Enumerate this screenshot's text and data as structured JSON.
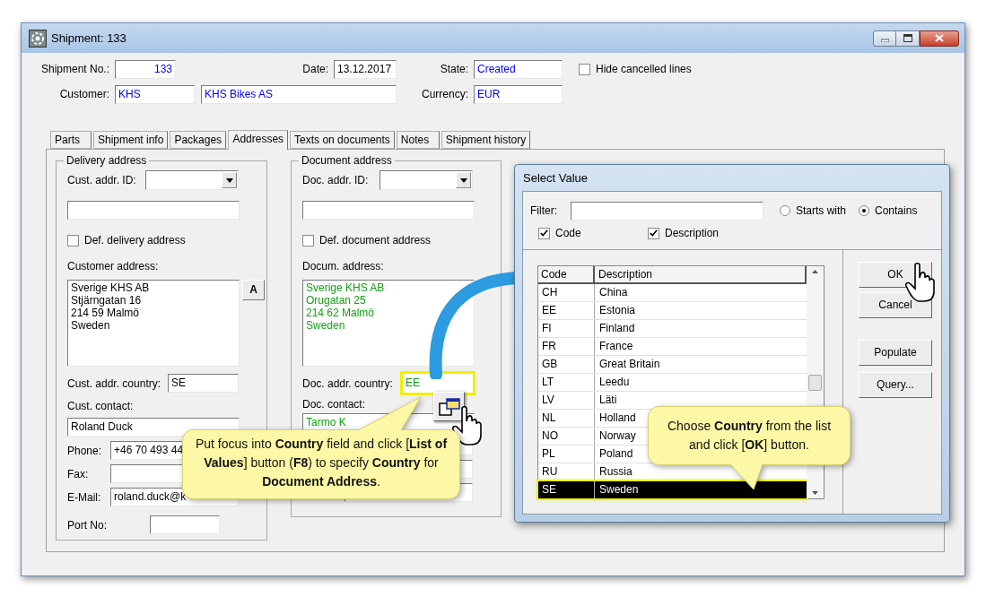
{
  "window": {
    "title": "Shipment: 133"
  },
  "header": {
    "shipment_no": {
      "label": "Shipment No.:",
      "value": "133"
    },
    "date": {
      "label": "Date:",
      "value": "13.12.2017"
    },
    "state": {
      "label": "State:",
      "value": "Created"
    },
    "hide_cancelled": {
      "label": "Hide cancelled lines",
      "checked": false
    },
    "customer": {
      "label": "Customer:",
      "code": "KHS",
      "name": "KHS Bikes AS"
    },
    "currency": {
      "label": "Currency:",
      "value": "EUR"
    }
  },
  "tabs": [
    {
      "label": "Parts",
      "selected": false
    },
    {
      "label": "Shipment info",
      "selected": false
    },
    {
      "label": "Packages",
      "selected": false
    },
    {
      "label": "Addresses",
      "selected": true
    },
    {
      "label": "Texts on documents",
      "selected": false
    },
    {
      "label": "Notes",
      "selected": false
    },
    {
      "label": "Shipment history",
      "selected": false
    }
  ],
  "delivery_address": {
    "title": "Delivery address",
    "addr_id_label": "Cust. addr. ID:",
    "default": {
      "label": "Def. delivery address",
      "checked": false
    },
    "address_label": "Customer address:",
    "address_lines": [
      "Sverige KHS AB",
      "Stjärngatan 16",
      "214 59 Malmö",
      "Sweden"
    ],
    "address_button": "A",
    "country_label": "Cust. addr. country:",
    "country": "SE",
    "contact_label": "Cust. contact:",
    "contact": "Roland Duck",
    "phone_label": "Phone:",
    "phone": "+46 70 493 44",
    "fax_label": "Fax:",
    "email_label": "E-Mail:",
    "email": "roland.duck@k",
    "port_label": "Port No:"
  },
  "document_address": {
    "title": "Document address",
    "addr_id_label": "Doc. addr. ID:",
    "default": {
      "label": "Def. document address",
      "checked": false
    },
    "address_label": "Docum. address:",
    "address_lines": [
      "Sverige KHS AB",
      "Orugatan 25",
      "214 62 Malmö",
      "Sweden"
    ],
    "country_label": "Doc. addr. country:",
    "country": "EE",
    "contact_label": "Doc. contact:",
    "contact": "Tarmo K"
  },
  "select_dialog": {
    "title": "Select Value",
    "filter_label": "Filter:",
    "match_options": [
      {
        "label": "Starts with",
        "selected": false
      },
      {
        "label": "Contains",
        "selected": true
      }
    ],
    "search_in": [
      {
        "label": "Code",
        "checked": true
      },
      {
        "label": "Description",
        "checked": true
      }
    ],
    "columns": [
      "Code",
      "Description"
    ],
    "rows": [
      {
        "code": "CH",
        "description": "China",
        "selected": false
      },
      {
        "code": "EE",
        "description": "Estonia",
        "selected": false
      },
      {
        "code": "FI",
        "description": "Finland",
        "selected": false
      },
      {
        "code": "FR",
        "description": "France",
        "selected": false
      },
      {
        "code": "GB",
        "description": "Great Britain",
        "selected": false
      },
      {
        "code": "LT",
        "description": "Leedu",
        "selected": false
      },
      {
        "code": "LV",
        "description": "Läti",
        "selected": false
      },
      {
        "code": "NL",
        "description": "Holland",
        "selected": false
      },
      {
        "code": "NO",
        "description": "Norway",
        "selected": false
      },
      {
        "code": "PL",
        "description": "Poland",
        "selected": false
      },
      {
        "code": "RU",
        "description": "Russia",
        "selected": false
      },
      {
        "code": "SE",
        "description": "Sweden",
        "selected": true
      }
    ],
    "buttons": [
      "OK",
      "Cancel",
      "Populate",
      "Query..."
    ]
  },
  "callouts": [
    {
      "text": "Put focus into **Country** field and click [**List of Values**] button (**F8**) to specify **Country** for **Document Address**."
    },
    {
      "text": "Choose **Country** from the list and click [**OK**] button."
    }
  ]
}
